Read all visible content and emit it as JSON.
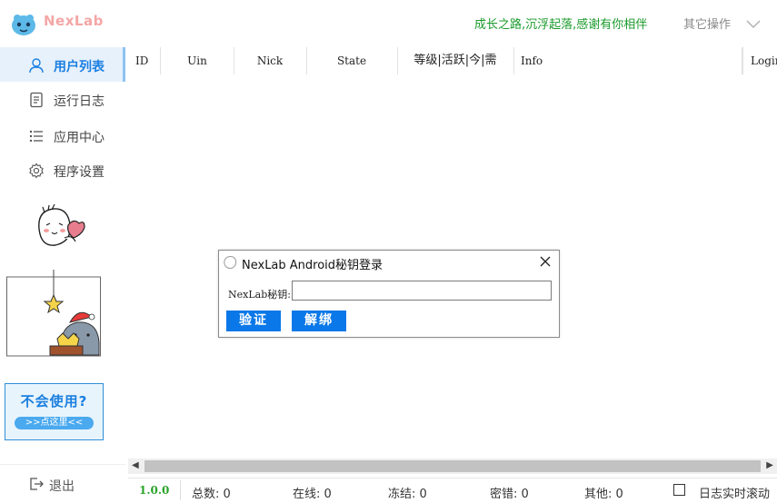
{
  "header": {
    "brand": "NexLab",
    "slogan": "成长之路,沉浮起落,感谢有你相伴",
    "other_ops": "其它操作"
  },
  "sidebar": {
    "items": [
      {
        "label": "用户列表",
        "icon": "user-icon",
        "active": true
      },
      {
        "label": "运行日志",
        "icon": "document-icon",
        "active": false
      },
      {
        "label": "应用中心",
        "icon": "list-icon",
        "active": false
      },
      {
        "label": "程序设置",
        "icon": "gear-icon",
        "active": false
      }
    ],
    "help": {
      "title": "不会使用?",
      "link": ">>点这里<<"
    },
    "exit": "退出"
  },
  "table": {
    "columns": [
      "ID",
      "Uin",
      "Nick",
      "State",
      "等级|活跃|今|需",
      "Info",
      "Login"
    ],
    "rows": []
  },
  "statusbar": {
    "version": "1.0.0",
    "total": "总数: 0",
    "online": "在线: 0",
    "frozen": "冻结: 0",
    "pwd_error": "密错: 0",
    "other": "其他: 0",
    "autoscroll": "日志实时滚动"
  },
  "dialog": {
    "title": "NexLab Android秘钥登录",
    "field_label": "NexLab秘钥:",
    "field_value": "",
    "verify": "验证",
    "unbind": "解绑"
  },
  "colors": {
    "accent": "#1b7fe0",
    "slogan": "#1a9a2a",
    "brand": "#f4a6a6",
    "button": "#0a78e8"
  }
}
